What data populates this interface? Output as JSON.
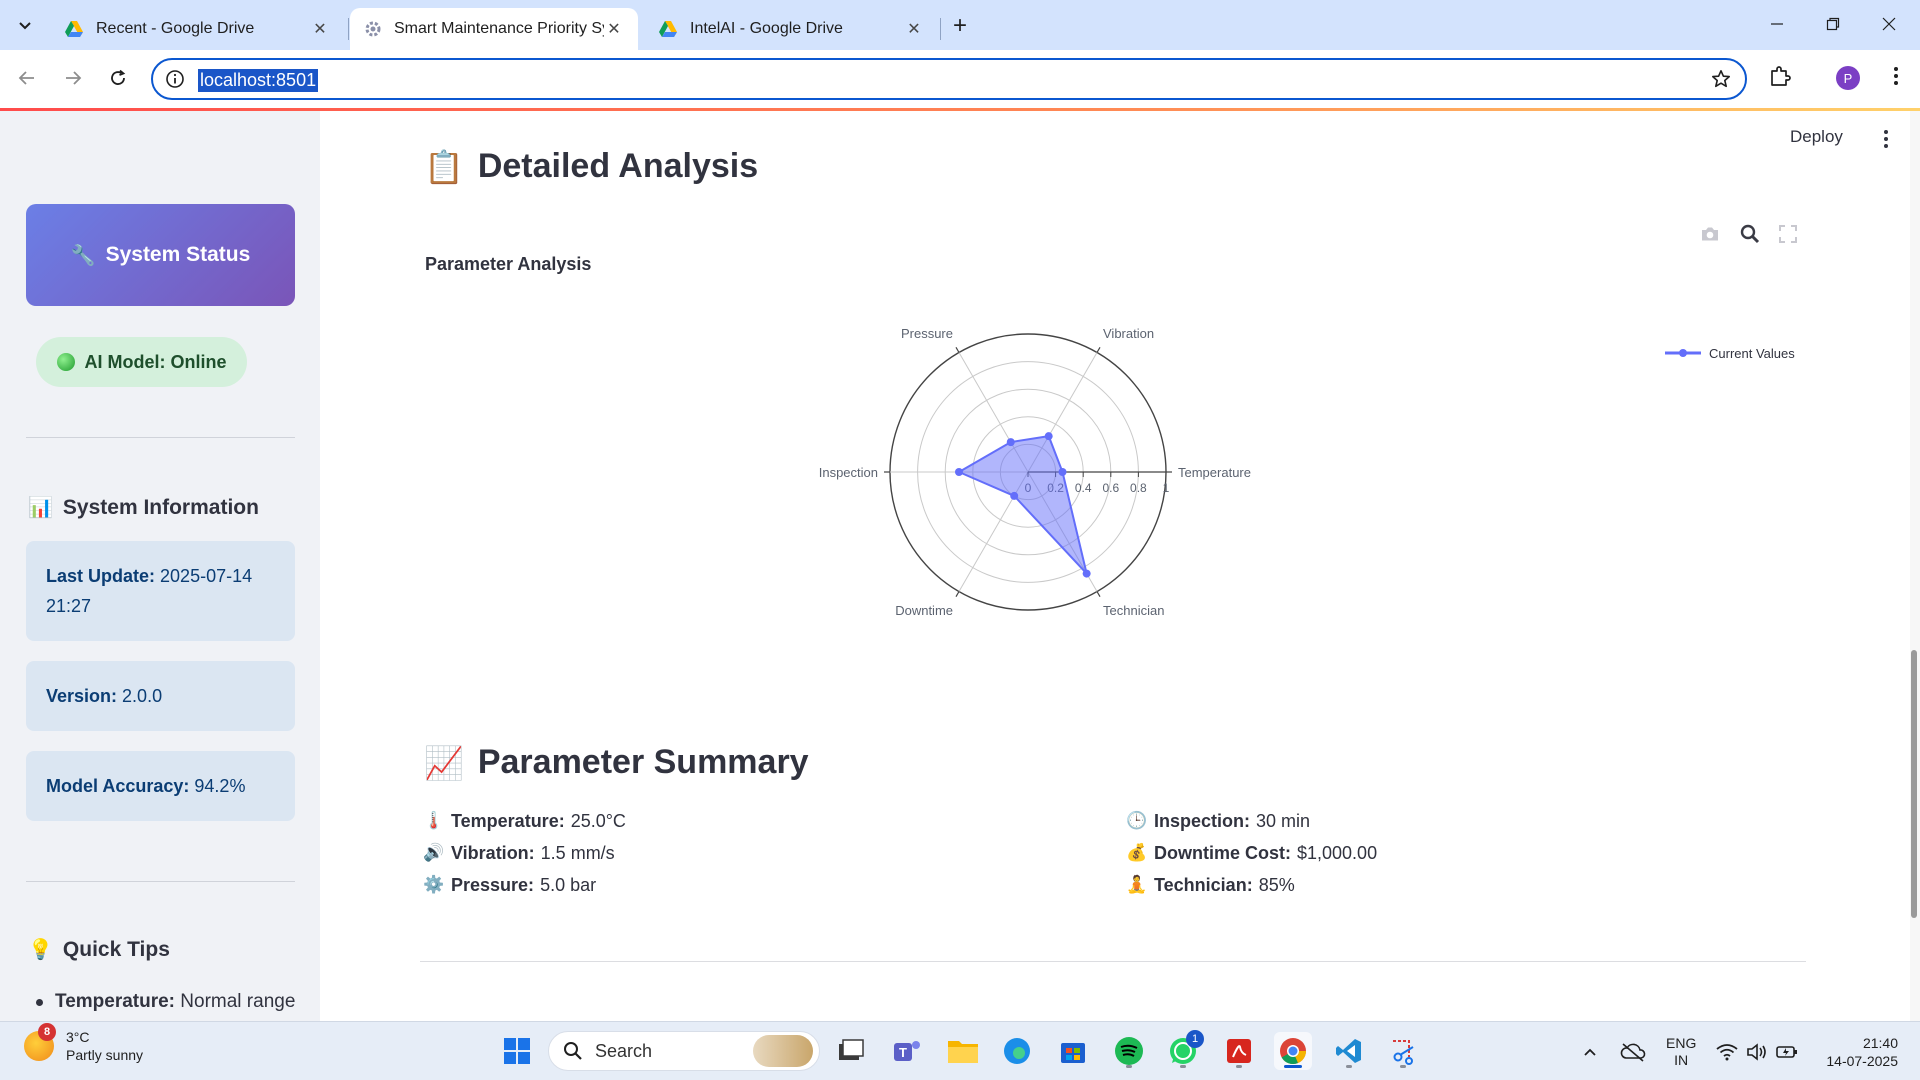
{
  "browser": {
    "tabs": [
      {
        "title": "Recent - Google Drive",
        "icon": "google-drive-icon",
        "active": false
      },
      {
        "title": "Smart Maintenance Priority System",
        "icon": "streamlit-gear-icon",
        "active": true
      },
      {
        "title": "IntelAI - Google Drive",
        "icon": "google-drive-icon",
        "active": false
      }
    ],
    "url": "localhost:8501",
    "profile_initial": "P"
  },
  "sidebar": {
    "status_card": "System Status",
    "model_status": "AI Model: Online",
    "info_heading": "System Information",
    "info_cards": [
      {
        "label": "Last Update:",
        "value": "2025-07-14 21:27"
      },
      {
        "label": "Version:",
        "value": "2.0.0"
      },
      {
        "label": "Model Accuracy:",
        "value": "94.2%"
      }
    ],
    "tips_heading": "Quick Tips",
    "tips": [
      {
        "label": "Temperature:",
        "value": "Normal range"
      }
    ]
  },
  "main": {
    "deploy_label": "Deploy",
    "detailed_heading": "Detailed Analysis",
    "summary_heading": "Parameter Summary",
    "summary_left": [
      {
        "emoji": "🌡️",
        "label": "Temperature:",
        "value": "25.0°C"
      },
      {
        "emoji": "🔊",
        "label": "Vibration:",
        "value": "1.5 mm/s"
      },
      {
        "emoji": "⚙️",
        "label": "Pressure:",
        "value": "5.0 bar"
      }
    ],
    "summary_right": [
      {
        "emoji": "🕒",
        "label": "Inspection:",
        "value": "30 min"
      },
      {
        "emoji": "💰",
        "label": "Downtime Cost:",
        "value": "$1,000.00"
      },
      {
        "emoji": "🧘",
        "label": "Technician:",
        "value": "85%"
      }
    ]
  },
  "chart_data": {
    "type": "radar",
    "title": "Parameter Analysis",
    "categories": [
      "Temperature",
      "Vibration",
      "Pressure",
      "Inspection",
      "Downtime",
      "Technician"
    ],
    "series": [
      {
        "name": "Current Values",
        "values": [
          0.25,
          0.3,
          0.25,
          0.5,
          0.2,
          0.85
        ],
        "color": "#636efa"
      }
    ],
    "radial_range": [
      0,
      1
    ],
    "radial_ticks": [
      "0",
      "0.2",
      "0.4",
      "0.6",
      "0.8",
      "1"
    ],
    "legend": "top-right"
  },
  "taskbar": {
    "weather_temp": "3°C",
    "weather_desc": "Partly sunny",
    "weather_badge": "8",
    "search_placeholder": "Search",
    "whatsapp_badge": "1",
    "lang_top": "ENG",
    "lang_bottom": "IN",
    "time": "21:40",
    "date": "14-07-2025"
  }
}
